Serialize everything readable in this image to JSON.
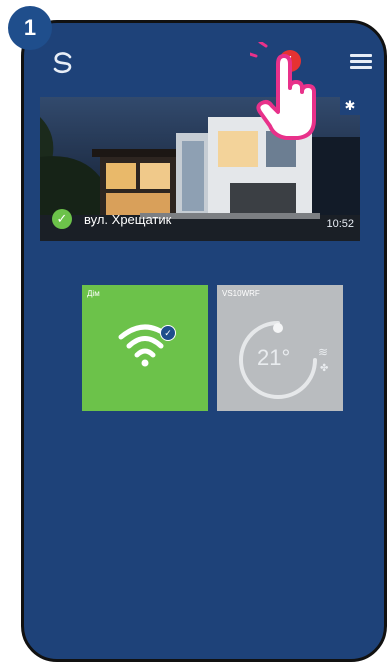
{
  "step_number": "1",
  "header": {
    "alert_symbol": "!",
    "menu_icon": "hamburger-icon",
    "logo_icon": "s-logo-icon"
  },
  "banner": {
    "address": "вул. Хрещатик",
    "time": "10:52",
    "settings_icon": "gear-icon",
    "status_icon": "check-icon"
  },
  "tiles": [
    {
      "title": "Дім",
      "icon": "wifi-icon",
      "status": "check-icon",
      "color": "#6cc24a"
    },
    {
      "title": "VS10WRF",
      "temperature": "21°",
      "icon": "gauge-icon",
      "color": "#b9bcbf"
    }
  ],
  "colors": {
    "background": "#1e4279",
    "alert": "#e53232",
    "accent_green": "#6cc24a",
    "badge": "#1f4e8c",
    "hand": "#e8318a"
  }
}
